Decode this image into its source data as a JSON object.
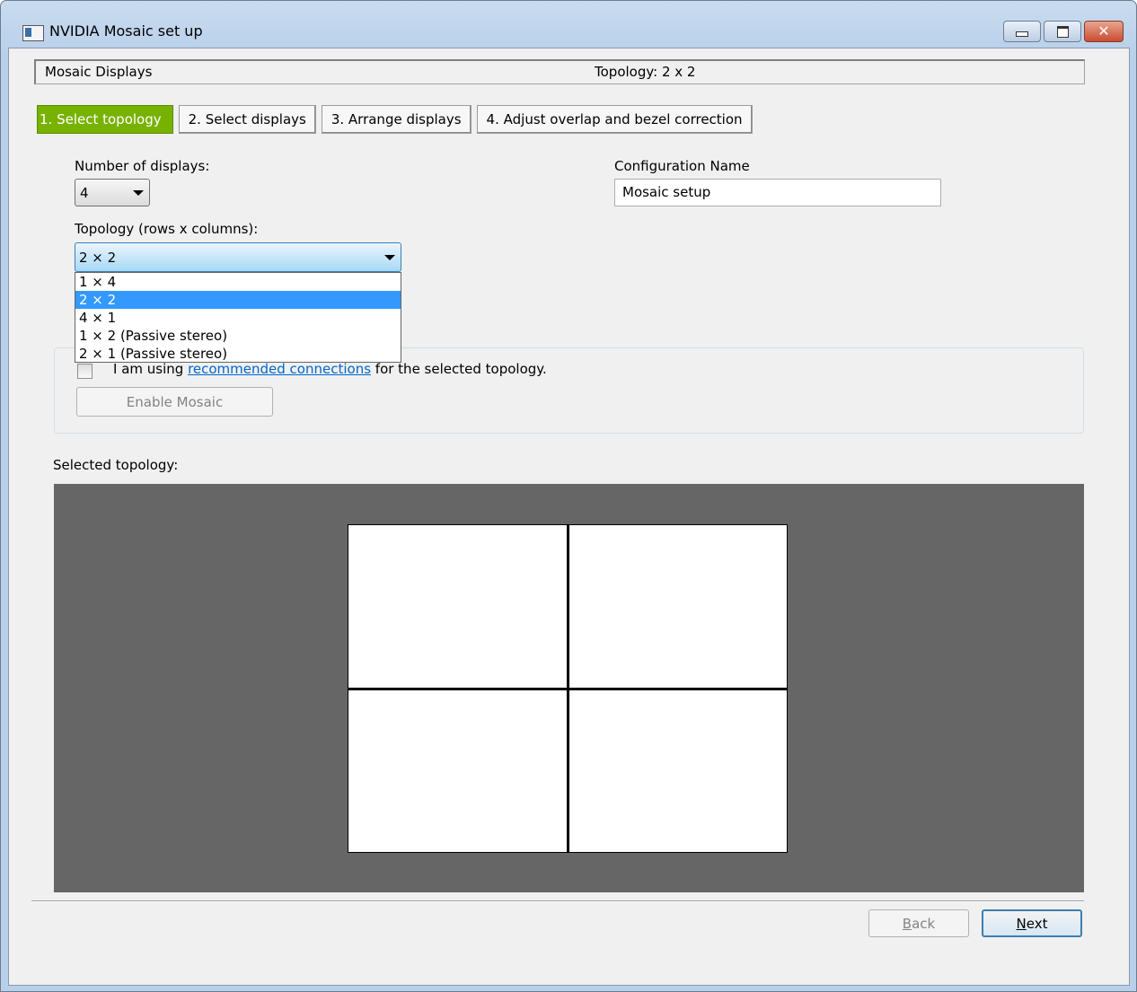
{
  "window": {
    "title": "NVIDIA Mosaic set up",
    "icon": "app-icon",
    "controls": [
      "minimize-icon",
      "maximize-icon",
      "close-icon"
    ],
    "close_glyph": "✕"
  },
  "header": {
    "left": "Mosaic Displays",
    "right": "Topology: 2 x 2"
  },
  "tabs": [
    {
      "label": "1. Select topology",
      "active": true
    },
    {
      "label": "2. Select displays",
      "active": false
    },
    {
      "label": "3. Arrange displays",
      "active": false
    },
    {
      "label": "4. Adjust overlap and bezel correction",
      "active": false
    }
  ],
  "displays": {
    "label": "Number of displays:",
    "value": "4"
  },
  "config": {
    "label": "Configuration Name",
    "value": "Mosaic setup"
  },
  "topology": {
    "label": "Topology (rows x columns):",
    "value": "2 × 2",
    "options": [
      "1 × 4",
      "2 × 2",
      "4 × 1",
      "1 × 2  (Passive stereo)",
      "2 × 1  (Passive stereo)"
    ],
    "selected_index": 1
  },
  "connections": {
    "prefix": "I am using ",
    "link": "recommended connections",
    "suffix": " for the selected topology.",
    "checked": false
  },
  "enable_button": "Enable Mosaic",
  "preview": {
    "label": "Selected topology:",
    "rows": 2,
    "columns": 2
  },
  "buttons": {
    "back_accel": "B",
    "back_rest": "ack",
    "next_accel": "N",
    "next_rest": "ext"
  },
  "colors": {
    "active_tab": "#78b200",
    "preview_bg": "#666666",
    "selection": "#3399ff",
    "link": "#0066cc"
  }
}
